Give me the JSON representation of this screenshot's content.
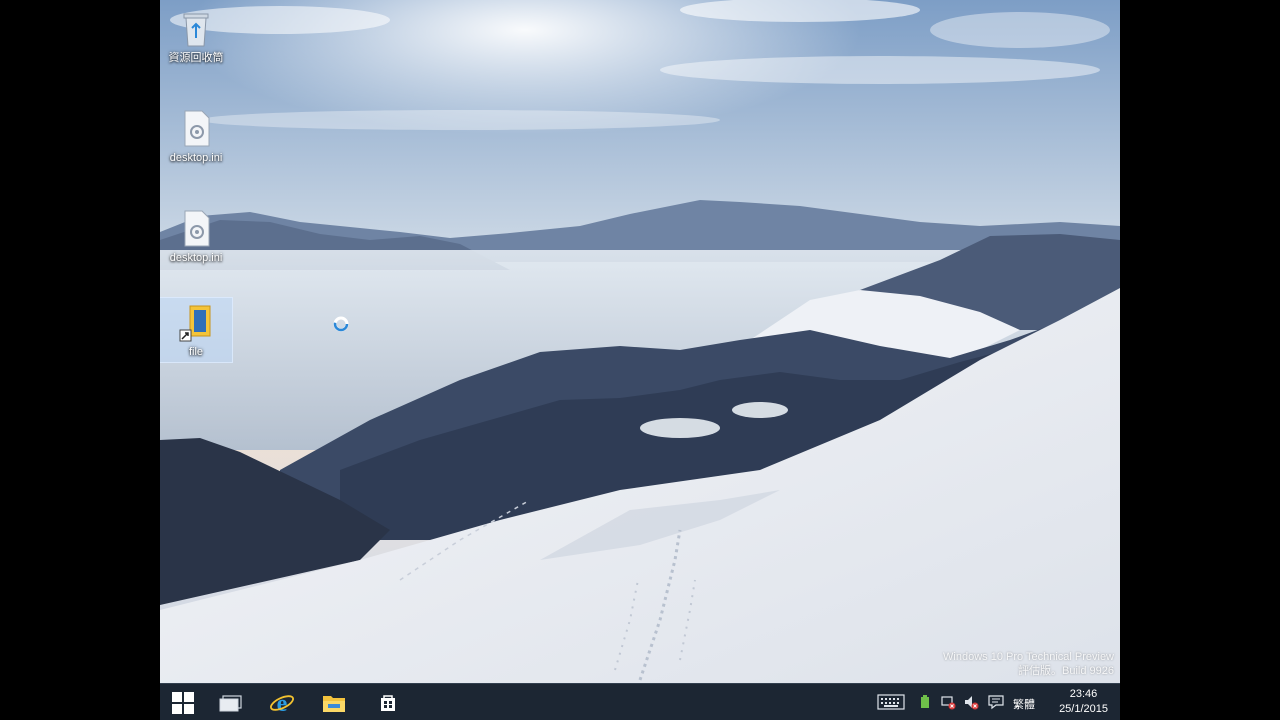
{
  "desktop": {
    "icons": [
      {
        "label": "資源回收筒",
        "icon": "recycle-bin-icon"
      },
      {
        "label": "desktop.ini",
        "icon": "settings-file-icon"
      },
      {
        "label": "desktop.ini",
        "icon": "settings-file-icon"
      },
      {
        "label": "file",
        "icon": "shortcut-icon",
        "selected": true
      }
    ],
    "watermark": {
      "line1": "Windows 10 Pro Technical Preview",
      "line2": "評估版。Build 9926"
    }
  },
  "taskbar": {
    "buttons": [
      {
        "name": "start-button",
        "icon": "windows-logo-icon"
      },
      {
        "name": "task-view-button",
        "icon": "task-view-icon"
      },
      {
        "name": "internet-explorer-button",
        "icon": "ie-icon"
      },
      {
        "name": "file-explorer-button",
        "icon": "folder-icon"
      },
      {
        "name": "store-button",
        "icon": "store-icon"
      }
    ],
    "tray": {
      "icons": [
        "keyboard-icon",
        "power-icon",
        "network-icon",
        "volume-icon",
        "action-center-icon"
      ],
      "language": "繁體",
      "time": "23:46",
      "date": "25/1/2015"
    }
  },
  "colors": {
    "taskbar": "#1c2633",
    "accent": "#2b88d8"
  }
}
